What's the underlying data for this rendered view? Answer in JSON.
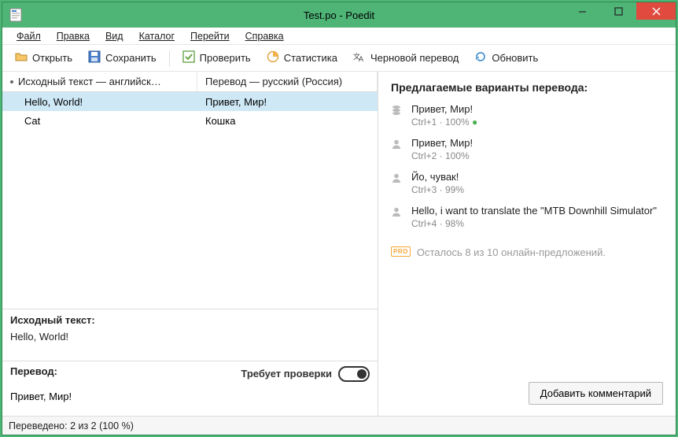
{
  "title": "Test.po - Poedit",
  "menu": {
    "file": "Файл",
    "edit": "Правка",
    "view": "Вид",
    "catalog": "Каталог",
    "go": "Перейти",
    "help": "Справка"
  },
  "toolbar": {
    "open": "Открыть",
    "save": "Сохранить",
    "validate": "Проверить",
    "stats": "Статистика",
    "pretranslate": "Черновой перевод",
    "update": "Обновить"
  },
  "table": {
    "col_source": "Исходный текст — английск…",
    "col_target": "Перевод — русский (Россия)",
    "rows": [
      {
        "src": "Hello, World!",
        "tgt": "Привет, Мир!",
        "selected": true
      },
      {
        "src": "Cat",
        "tgt": "Кошка",
        "selected": false
      }
    ]
  },
  "source": {
    "label": "Исходный текст:",
    "text": "Hello, World!"
  },
  "translation": {
    "label": "Перевод:",
    "needs_work_label": "Требует проверки",
    "text": "Привет, Мир!"
  },
  "suggest": {
    "title": "Предлагаемые варианты перевода:",
    "items": [
      {
        "icon": "db",
        "text": "Привет, Мир!",
        "meta": "Ctrl+1 · 100%",
        "check": true
      },
      {
        "icon": "user",
        "text": "Привет, Мир!",
        "meta": "Ctrl+2 · 100%",
        "check": false
      },
      {
        "icon": "user",
        "text": "Йо, чувак!",
        "meta": "Ctrl+3 · 99%",
        "check": false
      },
      {
        "icon": "user",
        "text": "Hello, i want to translate the \"MTB Downhill Simulator\"",
        "meta": "Ctrl+4 · 98%",
        "check": false
      }
    ],
    "remaining": "Осталось 8 из 10 онлайн-предложений."
  },
  "add_comment": "Добавить комментарий",
  "status": "Переведено: 2 из 2 (100 %)"
}
